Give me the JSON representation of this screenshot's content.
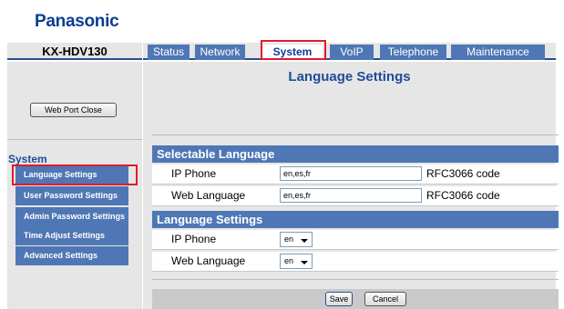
{
  "header": {
    "brand": "Panasonic",
    "model": "KX-HDV130"
  },
  "tabs": [
    {
      "label": "Status",
      "active": false
    },
    {
      "label": "Network",
      "active": false
    },
    {
      "label": "System",
      "active": true
    },
    {
      "label": "VoIP",
      "active": false
    },
    {
      "label": "Telephone",
      "active": false
    },
    {
      "label": "Maintenance",
      "active": false
    }
  ],
  "sidebar": {
    "web_port_button": "Web Port Close",
    "section_title": "System",
    "items": [
      {
        "label": "Language Settings",
        "selected": true
      },
      {
        "label": "User Password Settings",
        "selected": false
      },
      {
        "label": "Admin Password Settings",
        "selected": false
      },
      {
        "label": "Time Adjust Settings",
        "selected": false
      },
      {
        "label": "Advanced Settings",
        "selected": false
      }
    ]
  },
  "main": {
    "page_title": "Language Settings",
    "selectable": {
      "heading": "Selectable Language",
      "rows": [
        {
          "label": "IP Phone",
          "value": "en,es,fr",
          "hint": "RFC3066 code"
        },
        {
          "label": "Web Language",
          "value": "en,es,fr",
          "hint": "RFC3066 code"
        }
      ]
    },
    "language": {
      "heading": "Language Settings",
      "rows": [
        {
          "label": "IP Phone",
          "value": "en"
        },
        {
          "label": "Web Language",
          "value": "en"
        }
      ]
    },
    "save_label": "Save",
    "cancel_label": "Cancel"
  },
  "colors": {
    "brand_blue": "#0a3d91",
    "tab_blue": "#4f77b5",
    "highlight_red": "#e3192b",
    "panel_gray": "#e6e6e6"
  }
}
